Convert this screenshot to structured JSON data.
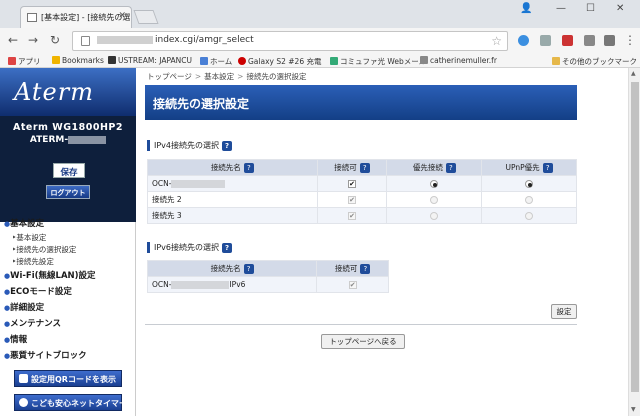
{
  "browser": {
    "tab_title": "[基本設定] - [接続先の選",
    "url_visible": "index.cgi/amgr_select",
    "bookmarks": [
      {
        "label": "アプリ",
        "icon": "apps-grid-icon",
        "color": "#d44"
      },
      {
        "label": "Bookmarks",
        "icon": "star-icon",
        "color": "#f0b400"
      },
      {
        "label": "USTREAM: JAPANCU",
        "icon": "ustream-icon",
        "color": "#333"
      },
      {
        "label": "ホーム",
        "icon": "home-icon",
        "color": "#4a80d6"
      },
      {
        "label": "Galaxy S2 #26 充電",
        "icon": "r-logo-icon",
        "color": "#c00"
      },
      {
        "label": "コミュファ光 Webメール",
        "icon": "mail-icon",
        "color": "#3a7"
      },
      {
        "label": "catherinemuller.fr",
        "icon": "page-icon",
        "color": "#888"
      },
      {
        "label": "その他のブックマーク",
        "icon": "folder-icon",
        "color": "#e6b84a"
      }
    ]
  },
  "sidebar": {
    "logo": "Aterm",
    "model": "Aterm WG1800HP2",
    "ssid_prefix": "ATERM-",
    "save_label": "保存",
    "logout_label": "ログアウト",
    "menu": [
      {
        "type": "head",
        "label": "基本設定"
      },
      {
        "type": "sub",
        "label": "‣基本設定"
      },
      {
        "type": "sub",
        "label": "‣接続先の選択設定"
      },
      {
        "type": "sub",
        "label": "‣接続先設定"
      },
      {
        "type": "head",
        "label": "Wi-Fi(無線LAN)設定"
      },
      {
        "type": "head",
        "label": "ECOモード設定"
      },
      {
        "type": "head",
        "label": "詳細設定"
      },
      {
        "type": "head",
        "label": "メンテナンス"
      },
      {
        "type": "head",
        "label": "情報"
      },
      {
        "type": "head",
        "label": "悪質サイトブロック"
      }
    ],
    "qr_label": "設定用QRコードを表示",
    "kids_label": "こども安心ネットタイマー"
  },
  "main": {
    "breadcrumb": [
      "トップページ",
      "基本設定",
      "接続先の選択設定"
    ],
    "title": "接続先の選択設定",
    "ipv4": {
      "heading": "IPv4接続先の選択",
      "columns": [
        "接続先名",
        "接続可",
        "優先接続",
        "UPnP優先"
      ],
      "rows": [
        {
          "name": "OCN-",
          "enabled": "✔",
          "priority": true,
          "upnp": true,
          "disabled": false
        },
        {
          "name": "接続先 2",
          "enabled": "✔",
          "priority": false,
          "upnp": false,
          "disabled": true
        },
        {
          "name": "接続先 3",
          "enabled": "✔",
          "priority": false,
          "upnp": false,
          "disabled": true
        }
      ]
    },
    "ipv6": {
      "heading": "IPv6接続先の選択",
      "columns": [
        "接続先名",
        "接続可"
      ],
      "rows": [
        {
          "name_prefix": "OCN-",
          "name_suffix": "IPv6",
          "enabled": "✔"
        }
      ]
    },
    "help_glyph": "?",
    "set_label": "設定",
    "top_label": "トップページへ戻る"
  }
}
